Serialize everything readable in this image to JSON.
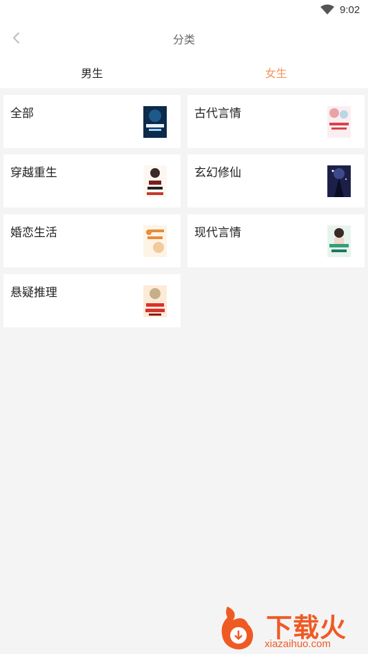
{
  "status_bar": {
    "time": "9:02",
    "icons": [
      "wifi-icon"
    ]
  },
  "nav": {
    "title": "分类",
    "back_icon": "chevron-left-icon"
  },
  "tabs": [
    {
      "label": "男生",
      "active": false
    },
    {
      "label": "女生",
      "active": true,
      "color": "#f3945a"
    }
  ],
  "categories": [
    {
      "label": "全部",
      "cover_colors": [
        "#0c2a4a",
        "#1d5a8a"
      ]
    },
    {
      "label": "古代言情",
      "cover_colors": [
        "#fbeef0",
        "#e9a3a8"
      ]
    },
    {
      "label": "穿越重生",
      "cover_colors": [
        "#fdf7f2",
        "#c23b2c"
      ]
    },
    {
      "label": "玄幻修仙",
      "cover_colors": [
        "#1c2048",
        "#3d4a8a"
      ]
    },
    {
      "label": "婚恋生活",
      "cover_colors": [
        "#fdf4e6",
        "#e98b3a"
      ]
    },
    {
      "label": "现代言情",
      "cover_colors": [
        "#e8f3ee",
        "#2fa07a"
      ]
    },
    {
      "label": "悬疑推理",
      "cover_colors": [
        "#fdebd8",
        "#d9322a"
      ]
    }
  ],
  "watermark": {
    "text": "下载火",
    "domain": "xiazaihuo.com"
  }
}
